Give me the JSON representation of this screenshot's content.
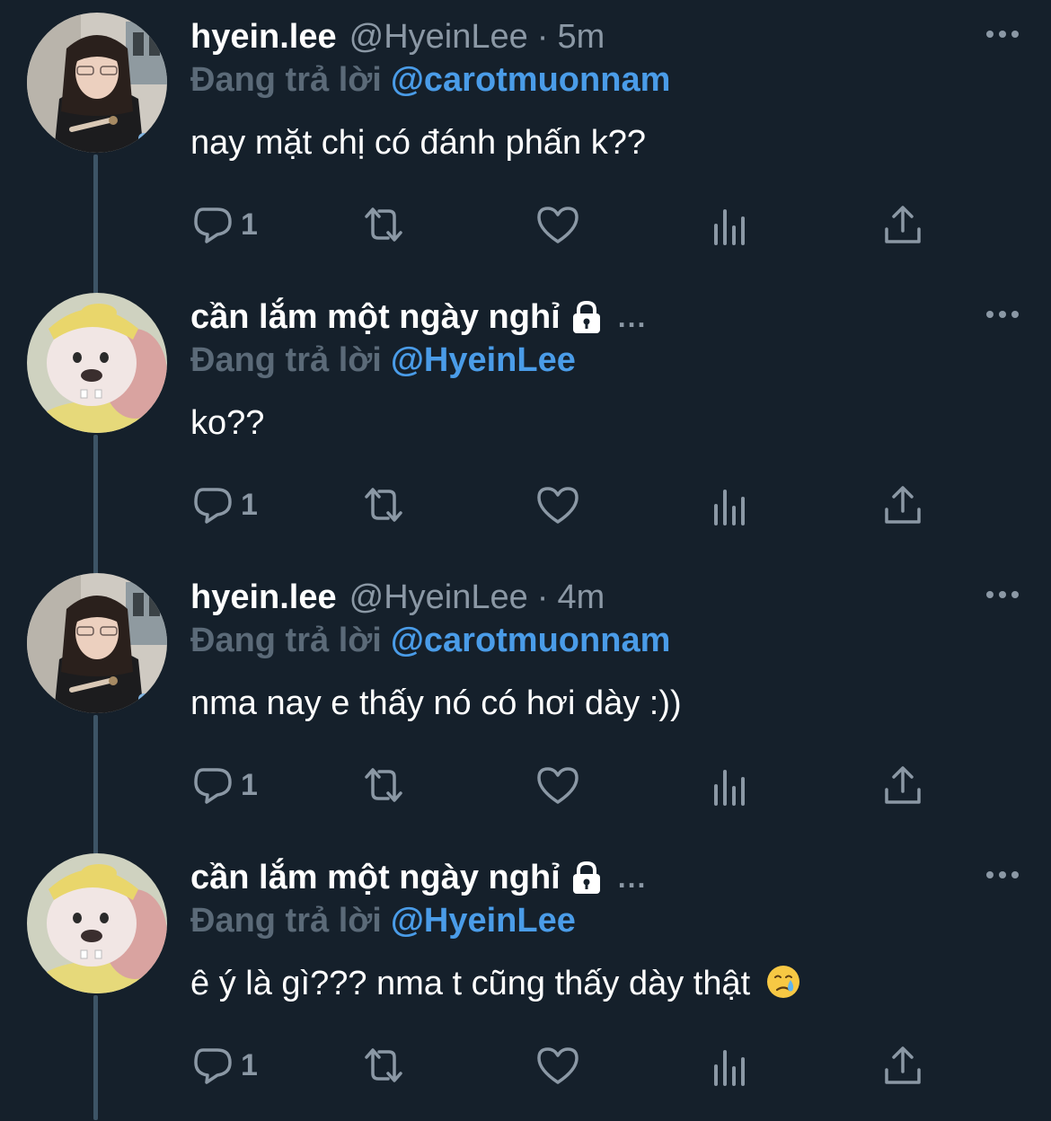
{
  "theme": {
    "background": "#15202b",
    "text": "#ffffff",
    "muted": "#8b98a5",
    "reply_prefix": "#5b6a78",
    "link": "#4a9ce8",
    "thread_line": "#3d5466"
  },
  "tweets": [
    {
      "display_name": "hyein.lee",
      "handle": "@HyeinLee",
      "separator": "·",
      "time": "5m",
      "locked": false,
      "reply_prefix": "Đang trả lời",
      "reply_to": "@carotmuonnam",
      "text": "nay mặt chị có đánh phấn k??",
      "reply_count": "1",
      "avatar": "girl-photo-avatar"
    },
    {
      "display_name": "cần lắm một ngày nghỉ",
      "name_ellipsis": "...",
      "locked": true,
      "reply_prefix": "Đang trả lời",
      "reply_to": "@HyeinLee",
      "text": "ko??",
      "reply_count": "1",
      "avatar": "cartoon-doll-avatar"
    },
    {
      "display_name": "hyein.lee",
      "handle": "@HyeinLee",
      "separator": "·",
      "time": "4m",
      "locked": false,
      "reply_prefix": "Đang trả lời",
      "reply_to": "@carotmuonnam",
      "text": "nma nay e thấy nó có hơi dày :))",
      "reply_count": "1",
      "avatar": "girl-photo-avatar"
    },
    {
      "display_name": "cần lắm một ngày nghỉ",
      "name_ellipsis": "...",
      "locked": true,
      "reply_prefix": "Đang trả lời",
      "reply_to": "@HyeinLee",
      "text": "ê ý là gì??? nma t cũng thấy dày thật",
      "emoji": "crying-face-emoji",
      "reply_count": "1",
      "avatar": "cartoon-doll-avatar"
    }
  ]
}
